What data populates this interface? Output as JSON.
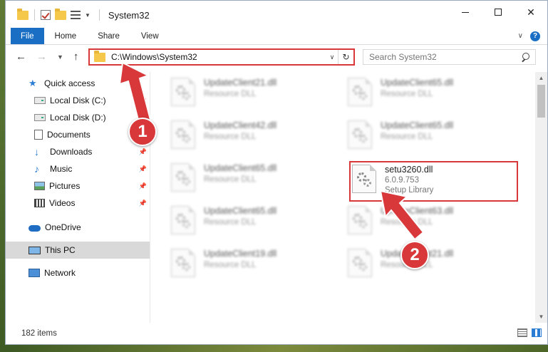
{
  "window": {
    "title": "System32"
  },
  "ribbon": {
    "tabs": [
      "File",
      "Home",
      "Share",
      "View"
    ]
  },
  "address": {
    "path": "C:\\Windows\\System32"
  },
  "search": {
    "placeholder": "Search System32"
  },
  "sidebar": {
    "items": [
      {
        "label": "Quick access",
        "icon": "star-icon"
      },
      {
        "label": "Local Disk (C:)",
        "icon": "drive-icon"
      },
      {
        "label": "Local Disk (D:)",
        "icon": "drive-icon"
      },
      {
        "label": "Documents",
        "icon": "documents-icon"
      },
      {
        "label": "Downloads",
        "icon": "downloads-icon"
      },
      {
        "label": "Music",
        "icon": "music-icon"
      },
      {
        "label": "Pictures",
        "icon": "pictures-icon"
      },
      {
        "label": "Videos",
        "icon": "videos-icon"
      },
      {
        "label": "OneDrive",
        "icon": "cloud-icon"
      },
      {
        "label": "This PC",
        "icon": "computer-icon",
        "selected": true
      },
      {
        "label": "Network",
        "icon": "network-icon"
      }
    ]
  },
  "files": [
    {
      "name": "UpdateClient21.dll",
      "desc": "Resource DLL"
    },
    {
      "name": "UpdateClient65.dll",
      "desc": "Resource DLL"
    },
    {
      "name": "UpdateClient42.dll",
      "desc": "Resource DLL"
    },
    {
      "name": "UpdateClient65.dll",
      "desc": "Resource DLL"
    },
    {
      "name": "UpdateClient65.dll",
      "desc": "Resource DLL"
    },
    {
      "name": "setu3260.dll",
      "version": "6.0.9.753",
      "desc": "Setup Library"
    },
    {
      "name": "UpdateClient65.dll",
      "desc": "Resource DLL"
    },
    {
      "name": "UpdateClient63.dll",
      "desc": "Resource DLL"
    },
    {
      "name": "UpdateClient19.dll",
      "desc": "Resource DLL"
    },
    {
      "name": "UpdateClient21.dll",
      "desc": "Resource DLL"
    }
  ],
  "status": {
    "item_count": "182 items"
  },
  "annotations": {
    "step1": "1",
    "step2": "2",
    "color": "#d9383a"
  }
}
